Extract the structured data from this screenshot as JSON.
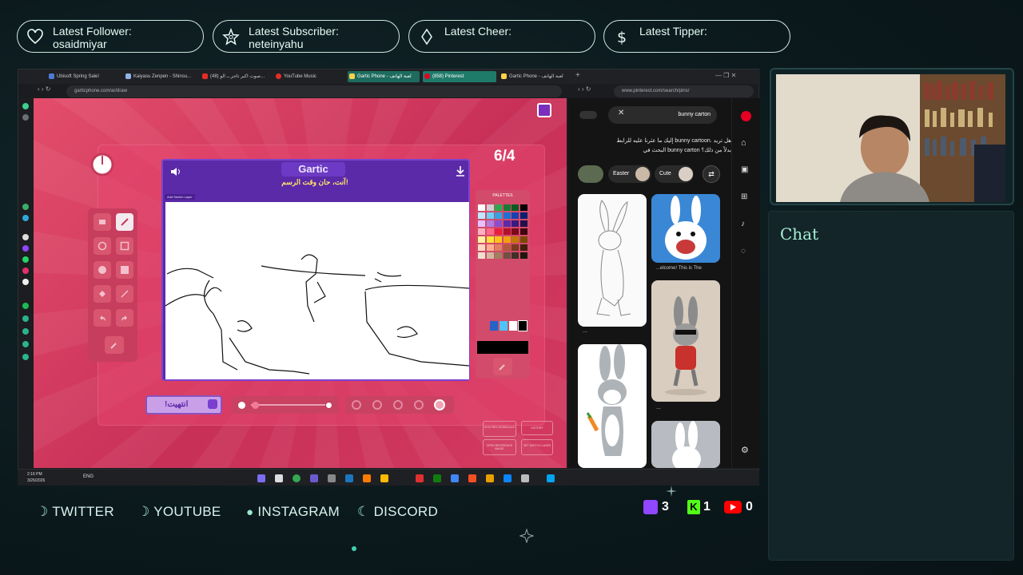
{
  "alerts": [
    {
      "title": "Latest Follower:",
      "value": "osaidmiyar",
      "icon": "heart-icon"
    },
    {
      "title": "Latest Subscriber:",
      "value": "neteinyahu",
      "icon": "star-icon"
    },
    {
      "title": "Latest Cheer:",
      "value": "",
      "icon": "diamond-icon"
    },
    {
      "title": "Latest Tipper:",
      "value": "",
      "icon": "dollar-icon"
    }
  ],
  "browser_left": {
    "tabs": [
      "Ubisoft Spring Sale!",
      "Kaiyasu Zenpen - Shinsu...",
      "(48) صوت اكبر تاجر ــ الو...",
      "YouTube Music",
      "Gartic Phone - لعبة الهاتف",
      "(858) Pinterest",
      "Gartic Phone - لعبة الهاتف"
    ],
    "url": "garticphone.com/ar/draw"
  },
  "gartic": {
    "logo": "Gartic",
    "prompt": "آنت، حان وقت الرسم!",
    "round": "6/4",
    "small_label": "Add Sketch Layer",
    "palettes_label": "PALETTES",
    "done_button": "!انتهيت",
    "mini_buttons": [
      "HIGH RES DOWNLOAD",
      "OPEN REFERENCE IMAGE",
      "HISTORY",
      "SET SKETCH LAYER"
    ]
  },
  "pinterest": {
    "url": "www.pinterest.com/search/pins/",
    "search": "bunny carton",
    "notice_line1": "إليك ما عثرنا عليه للرابط bunny cartoon. هل تريد",
    "notice_line2": "البحث في bunny carton بدلاً من ذلك؟",
    "chips": [
      "Easter",
      "Cute"
    ],
    "card_caption_1": "...",
    "card_caption_2": "...elcome! This is The",
    "card_caption_3": "...",
    "card_caption_4": "..."
  },
  "taskbar": {
    "time": "2:16 PM",
    "date": "3/26/2026",
    "lang": "ENG"
  },
  "socials": [
    {
      "label": "TWITTER",
      "icon": "moon-icon"
    },
    {
      "label": "YOUTUBE",
      "icon": "moon-icon"
    },
    {
      "label": "INSTAGRAM",
      "icon": "circle-icon"
    },
    {
      "label": "DISCORD",
      "icon": "moon-icon"
    }
  ],
  "viewer_counts": {
    "twitch": "3",
    "kick": "1",
    "youtube": "0"
  },
  "chat": {
    "title": "Chat"
  }
}
